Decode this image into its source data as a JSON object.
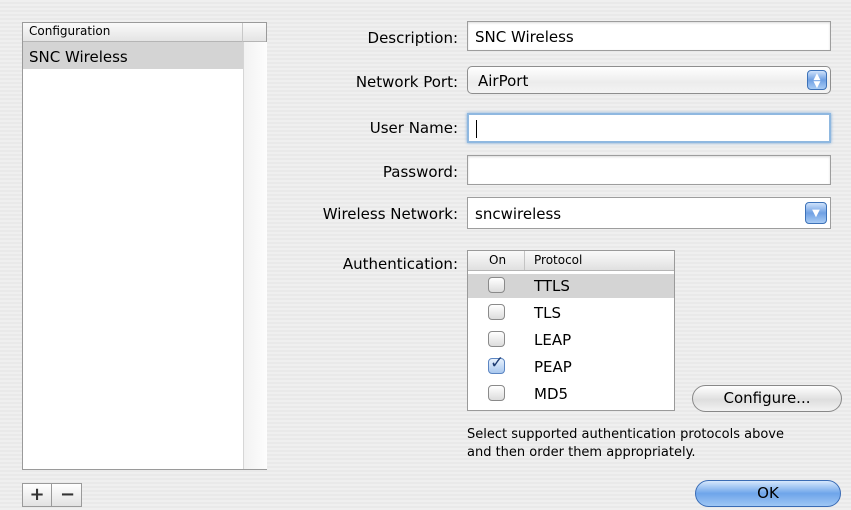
{
  "config_list": {
    "header": "Configuration",
    "items": [
      "SNC Wireless"
    ]
  },
  "list_buttons": {
    "add": "+",
    "remove": "−"
  },
  "form": {
    "description": {
      "label": "Description:",
      "value": "SNC Wireless"
    },
    "network_port": {
      "label": "Network Port:",
      "value": "AirPort"
    },
    "user_name": {
      "label": "User Name:",
      "value": ""
    },
    "password": {
      "label": "Password:",
      "value": ""
    },
    "wireless_network": {
      "label": "Wireless Network:",
      "value": "sncwireless"
    }
  },
  "authentication": {
    "label": "Authentication:",
    "columns": {
      "on": "On",
      "protocol": "Protocol"
    },
    "protocols": [
      {
        "name": "TTLS",
        "on": false
      },
      {
        "name": "TLS",
        "on": false
      },
      {
        "name": "LEAP",
        "on": false
      },
      {
        "name": "PEAP",
        "on": true
      },
      {
        "name": "MD5",
        "on": false
      }
    ],
    "configure_button": "Configure...",
    "hint_line1": "Select supported authentication protocols above",
    "hint_line2": "and then order them appropriately."
  },
  "ok_button": "OK",
  "colors": {
    "accent": "#6ea5ea",
    "selection": "#d4d4d4"
  },
  "icons": {
    "popup": "up-down-arrows-icon",
    "combo": "chevron-down-icon",
    "check": "checkmark-icon"
  }
}
